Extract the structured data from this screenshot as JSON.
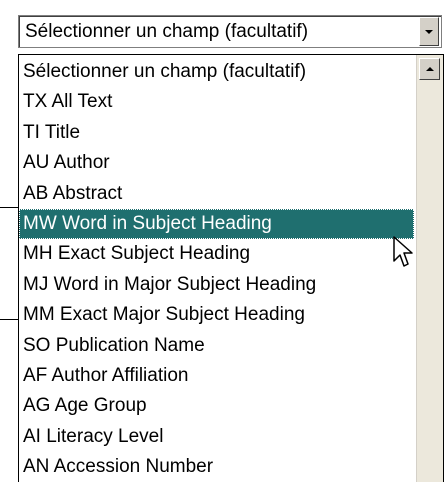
{
  "select": {
    "value": "Sélectionner un champ (facultatif)",
    "arrow_icon": "chevron-down-icon"
  },
  "dropdown": {
    "options": [
      {
        "label": "Sélectionner un champ (facultatif)"
      },
      {
        "label": "TX All Text"
      },
      {
        "label": "TI Title"
      },
      {
        "label": "AU Author"
      },
      {
        "label": "AB Abstract"
      },
      {
        "label": "MW Word in Subject Heading"
      },
      {
        "label": "MH Exact Subject Heading"
      },
      {
        "label": "MJ Word in Major Subject Heading"
      },
      {
        "label": "MM Exact Major Subject Heading"
      },
      {
        "label": "SO Publication Name"
      },
      {
        "label": "AF Author Affiliation"
      },
      {
        "label": "AG Age Group"
      },
      {
        "label": "AI Literacy Level"
      },
      {
        "label": "AN Accession Number"
      }
    ],
    "highlighted_index": 5,
    "highlight_color": "#1f6f6f"
  },
  "scrollbar": {
    "up_icon": "chevron-up-icon"
  }
}
